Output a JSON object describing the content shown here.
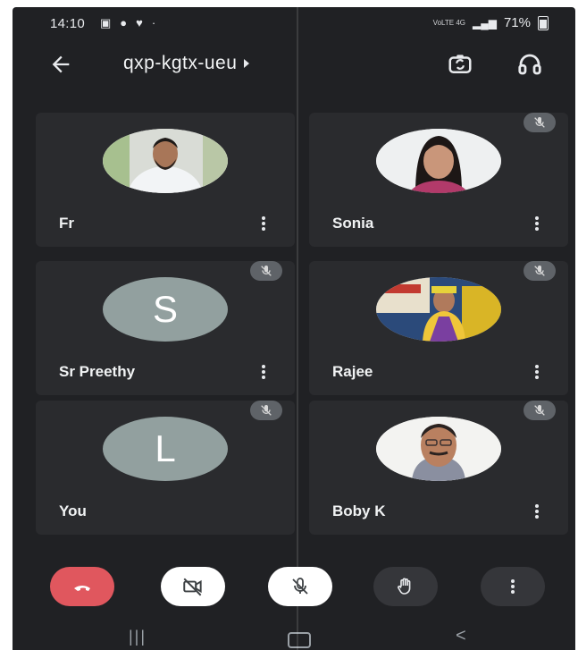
{
  "status_bar": {
    "time": "14:10",
    "battery": "71%",
    "network": "VoLTE 4G"
  },
  "app_bar": {
    "meeting_code": "qxp-kgtx-ueu"
  },
  "participants": [
    {
      "name": "Fr",
      "avatar_type": "photo",
      "muted": false
    },
    {
      "name": "Sonia",
      "avatar_type": "photo",
      "muted": true
    },
    {
      "name": "Sr Preethy",
      "avatar_type": "letter",
      "avatar_letter": "S",
      "muted": true
    },
    {
      "name": "Rajee",
      "avatar_type": "photo",
      "muted": true
    },
    {
      "name": "You",
      "avatar_type": "letter",
      "avatar_letter": "L",
      "muted": true
    },
    {
      "name": "Boby K",
      "avatar_type": "photo",
      "muted": true
    }
  ],
  "controls": [
    "end-call",
    "camera-off",
    "mic-off",
    "raise-hand",
    "more-options"
  ],
  "colors": {
    "background": "#202124",
    "tile": "#2a2b2e",
    "hangup": "#e0575e",
    "letter_avatar": "#92a09f"
  }
}
